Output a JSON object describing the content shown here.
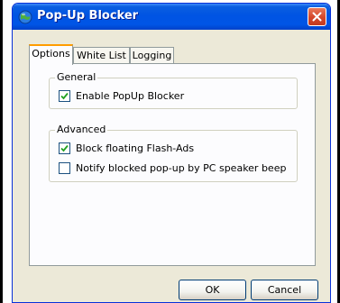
{
  "window": {
    "title": "Pop-Up Blocker",
    "icon": "globe-icon",
    "close_icon": "close-icon",
    "accent_color": "#0054e3"
  },
  "tabs": [
    {
      "label": "Options",
      "active": true
    },
    {
      "label": "White List",
      "active": false
    },
    {
      "label": "Logging",
      "active": false
    }
  ],
  "general": {
    "title": "General",
    "options": [
      {
        "label": "Enable PopUp Blocker",
        "checked": true
      }
    ]
  },
  "advanced": {
    "title": "Advanced",
    "options": [
      {
        "label": "Block floating Flash-Ads",
        "checked": true
      },
      {
        "label": "Notify blocked pop-up by PC speaker beep",
        "checked": false
      }
    ]
  },
  "buttons": {
    "ok": "OK",
    "cancel": "Cancel"
  }
}
